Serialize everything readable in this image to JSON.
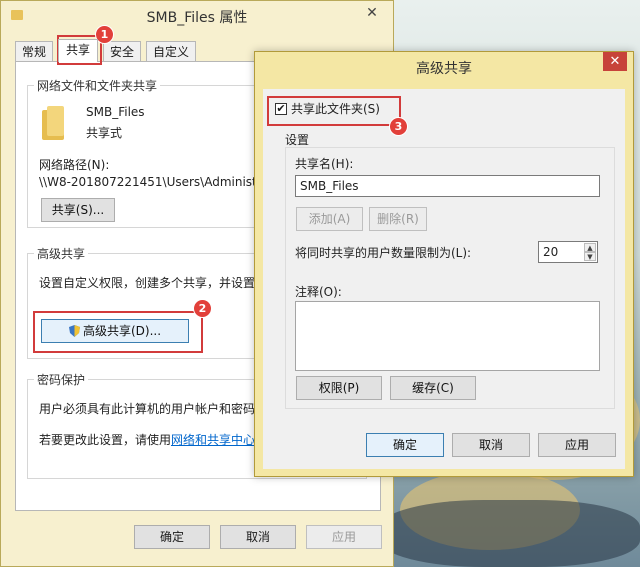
{
  "props_dialog": {
    "title": "SMB_Files 属性",
    "close_glyph": "✕",
    "tabs": [
      "常规",
      "共享",
      "安全",
      "自定义"
    ],
    "network_share_group": {
      "title": "网络文件和文件夹共享",
      "folder_name": "SMB_Files",
      "folder_status": "共享式",
      "network_path_label": "网络路径(N):",
      "network_path_value": "\\\\W8-201807221451\\Users\\Administrato",
      "share_button": "共享(S)..."
    },
    "advanced_group": {
      "title": "高级共享",
      "description": "设置自定义权限，创建多个共享，并设置其他",
      "advanced_button": "高级共享(D)..."
    },
    "password_group": {
      "title": "密码保护",
      "line1": "用户必须具有此计算机的用户帐户和密码，才",
      "line2_prefix": "若要更改此设置，请使用",
      "line2_link": "网络和共享中心",
      "line2_suffix": "。"
    },
    "buttons": {
      "ok": "确定",
      "cancel": "取消",
      "apply": "应用"
    }
  },
  "adv_dialog": {
    "title": "高级共享",
    "close_glyph": "✕",
    "share_checkbox_label": "共享此文件夹(S)",
    "share_checked": true,
    "settings_label": "设置",
    "share_name_label": "共享名(H):",
    "share_name_value": "SMB_Files",
    "add_button": "添加(A)",
    "remove_button": "删除(R)",
    "limit_label": "将同时共享的用户数量限制为(L):",
    "limit_value": "20",
    "comment_label": "注释(O):",
    "permissions_button": "权限(P)",
    "caching_button": "缓存(C)",
    "buttons": {
      "ok": "确定",
      "cancel": "取消",
      "apply": "应用"
    }
  },
  "annotations": [
    "1",
    "2",
    "3"
  ],
  "colors": {
    "annotation_red": "#d23b3b",
    "dialog_title_bg": "#f4e7a4",
    "link": "#0066cc"
  }
}
